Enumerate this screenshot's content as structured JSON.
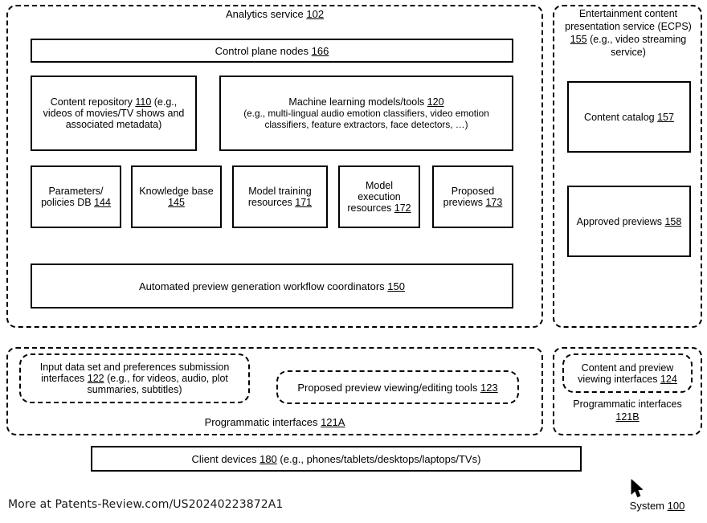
{
  "figure": {
    "system_label": "System 100",
    "footer_link": "More at Patents-Review.com/US20240223872A1"
  },
  "analytics_service": {
    "title_text": "Analytics service ",
    "title_ref": "102",
    "control_plane": {
      "text": "Control plane nodes ",
      "ref": "166"
    },
    "content_repository": {
      "line1_pre": "Content repository  ",
      "ref": "110",
      "line1_post": " (e.g.,",
      "line2": "videos of movies/TV shows and",
      "line3": "associated metadata)"
    },
    "ml_models": {
      "line1_pre": "Machine learning models/tools  ",
      "ref": "120",
      "line2": "(e.g., multi-lingual audio emotion classifiers, video emotion",
      "line3": "classifiers, feature extractors, face detectors, …)"
    },
    "resource_boxes": [
      {
        "name": "parameters-policies-db",
        "line1": "Parameters/",
        "line2_pre": "policies DB ",
        "ref": "144"
      },
      {
        "name": "knowledge-base",
        "line1": "Knowledge base",
        "line2_pre": "",
        "ref": "145"
      },
      {
        "name": "model-training-resources",
        "line1": "Model training",
        "line2_pre": "resources ",
        "ref": "171"
      },
      {
        "name": "model-execution-resources",
        "line1": "Model",
        "line2": "execution",
        "line3_pre": "resources ",
        "ref": "172"
      },
      {
        "name": "proposed-previews",
        "line1": "Proposed",
        "line2_pre": "previews ",
        "ref": "173"
      }
    ],
    "workflow_coordinators": {
      "text": "Automated preview generation workflow coordinators ",
      "ref": "150"
    }
  },
  "ecps_service": {
    "title_line1": "Entertainment content",
    "title_line2": "presentation service (ECPS)",
    "title_ref": "155",
    "title_line3_post": " (e.g., video streaming",
    "title_line4": "service)",
    "content_catalog": {
      "text": "Content catalog  ",
      "ref": "157"
    },
    "approved_previews": {
      "text": "Approved previews  ",
      "ref": "158"
    }
  },
  "programmatic_interfaces_a": {
    "label_text": "Programmatic interfaces  ",
    "label_ref": "121A",
    "input_interfaces": {
      "line1": "Input data set and preferences submission",
      "line2_pre": "interfaces ",
      "ref": "122",
      "line2_post": " (e.g., for videos, audio, plot",
      "line3": "summaries, subtitles)"
    },
    "preview_tools": {
      "text": "Proposed preview viewing/editing tools ",
      "ref": "123"
    }
  },
  "programmatic_interfaces_b": {
    "label_line1": "Programmatic interfaces",
    "label_ref": "121B",
    "content_preview_interfaces": {
      "line1": "Content and preview",
      "line2_pre": "viewing interfaces ",
      "ref": "124"
    }
  },
  "client_devices": {
    "text_pre": "Client devices  ",
    "ref": "180",
    "text_post": " (e.g., phones/tablets/desktops/laptops/TVs)"
  }
}
